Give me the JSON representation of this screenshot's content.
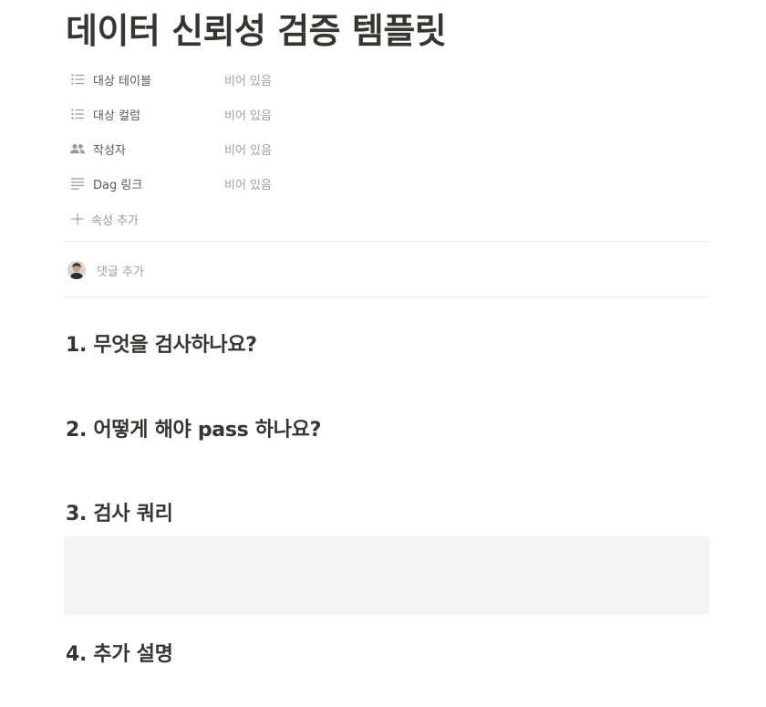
{
  "page": {
    "title": "데이터 신뢰성 검증 템플릿"
  },
  "properties": [
    {
      "icon": "list-icon",
      "label": "대상 테이블",
      "value": "비어 있음"
    },
    {
      "icon": "list-icon",
      "label": "대상 컬럼",
      "value": "비어 있음"
    },
    {
      "icon": "people-icon",
      "label": "작성자",
      "value": "비어 있음"
    },
    {
      "icon": "text-lines-icon",
      "label": "Dag 링크",
      "value": "비어 있음"
    }
  ],
  "add_property": {
    "icon": "plus-icon",
    "label": "속성 추가"
  },
  "comments": {
    "placeholder": "댓글 추가"
  },
  "sections": [
    {
      "heading": "1. 무엇을 검사하나요?"
    },
    {
      "heading": "2. 어떻게 해야 pass 하나요?"
    },
    {
      "heading": "3. 검사 쿼리"
    },
    {
      "heading": "4. 추가 설명"
    }
  ],
  "colors": {
    "text": "#37352f",
    "muted": "#a3a29e",
    "icon": "#9b9a97",
    "code_block_bg": "#f5f4f2",
    "divider": "#ebebea"
  }
}
